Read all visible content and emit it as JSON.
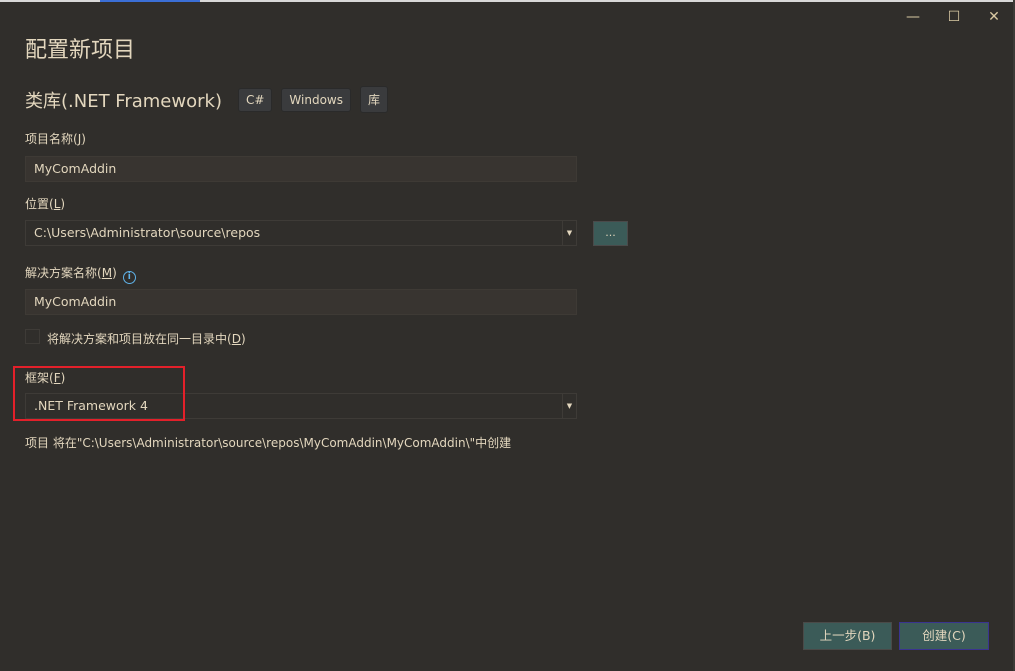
{
  "window": {
    "minimize_icon": "minimize",
    "maximize_icon": "maximize",
    "close_icon": "close"
  },
  "title": "配置新项目",
  "template": {
    "name": "类库(.NET Framework)",
    "tags": [
      "C#",
      "Windows",
      "库"
    ]
  },
  "project_name": {
    "label": "项目名称",
    "key": "J",
    "value": "MyComAddin"
  },
  "location": {
    "label": "位置",
    "key": "L",
    "value": "C:\\Users\\Administrator\\source\\repos",
    "browse_label": "..."
  },
  "solution_name": {
    "label": "解决方案名称",
    "key": "M",
    "value": "MyComAddin",
    "info_icon": "i"
  },
  "same_dir": {
    "label": "将解决方案和项目放在同一目录中",
    "key": "D",
    "checked": false
  },
  "framework": {
    "label": "框架",
    "key": "F",
    "value": ".NET Framework 4"
  },
  "path_note": "项目 将在\"C:\\Users\\Administrator\\source\\repos\\MyComAddin\\MyComAddin\\\"中创建",
  "buttons": {
    "back": "上一步(B)",
    "create": "创建(C)"
  },
  "colors": {
    "background": "#302e2b",
    "text": "#e3d7be",
    "button": "#3b5b58",
    "highlight": "#e3202a"
  }
}
